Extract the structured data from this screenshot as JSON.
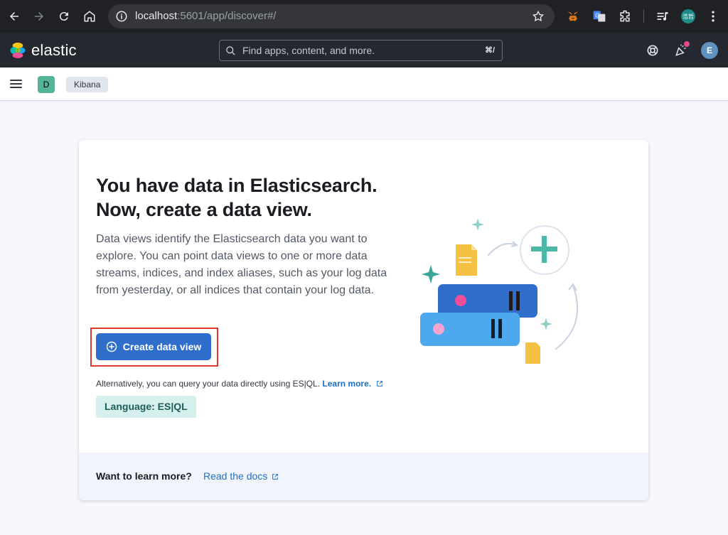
{
  "browser": {
    "url_host": "localhost",
    "url_rest": ":5601/app/discover#/",
    "profile_label": "浩哲"
  },
  "header": {
    "logo_text": "elastic",
    "search_placeholder": "Find apps, content, and more.",
    "search_shortcut": "⌘/",
    "user_initial": "E"
  },
  "subheader": {
    "space_initial": "D",
    "breadcrumb": "Kibana"
  },
  "panel": {
    "title_line1": "You have data in Elasticsearch.",
    "title_line2": "Now, create a data view.",
    "description": "Data views identify the Elasticsearch data you want to explore. You can point data views to one or more data streams, indices, and index aliases, such as your log data from yesterday, or all indices that contain your log data.",
    "create_button": "Create data view",
    "alt_text": "Alternatively, you can query your data directly using ES|QL.",
    "alt_link": "Learn more.",
    "language_badge": "Language: ES|QL",
    "footer_question": "Want to learn more?",
    "footer_link": "Read the docs"
  },
  "colors": {
    "primary": "#2f6fcb",
    "header_bg": "#25282f",
    "browser_bg": "#202124",
    "link": "#1f6fc5",
    "highlight": "#e0382d"
  }
}
